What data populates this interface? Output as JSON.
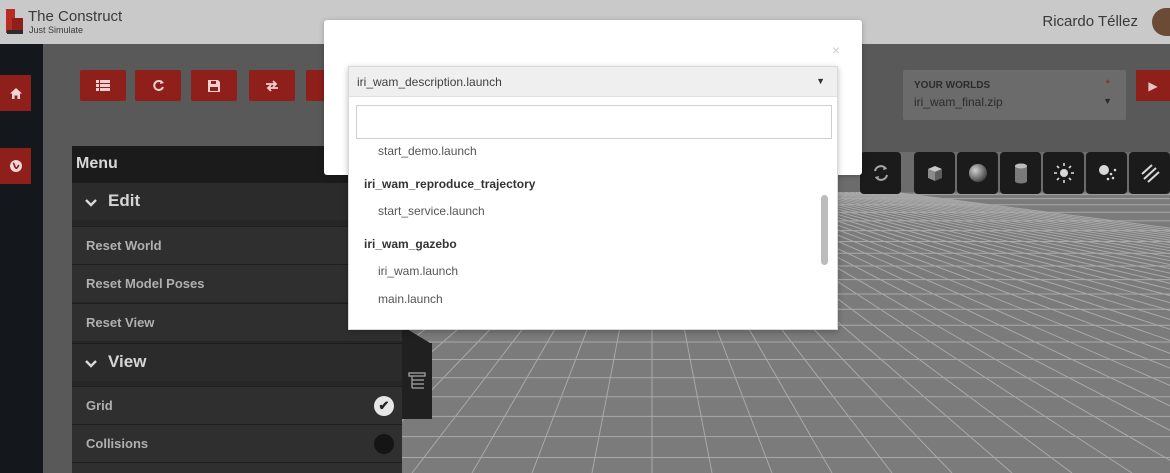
{
  "header": {
    "brand_title": "The Construct",
    "brand_subtitle": "Just Simulate",
    "user_name": "Ricardo Téllez"
  },
  "leftnav": {
    "items": [
      "home-icon",
      "globe-icon"
    ]
  },
  "toolbar": {
    "buttons": [
      "list-icon",
      "refresh-icon",
      "save-icon",
      "swap-icon",
      "extra-icon"
    ]
  },
  "worlds": {
    "label": "YOUR WORLDS",
    "required_mark": "*",
    "selected": "iri_wam_final.zip"
  },
  "view_tools": [
    "rotate-icon",
    "box-icon",
    "sphere-icon",
    "cylinder-icon",
    "sun-icon",
    "point-light-icon",
    "directional-light-icon"
  ],
  "menu": {
    "title": "Menu",
    "sections": [
      {
        "title": "Edit",
        "items": [
          "Reset World",
          "Reset Model Poses",
          "Reset View"
        ]
      },
      {
        "title": "View",
        "items": [
          "Grid",
          "Collisions"
        ]
      }
    ],
    "grid_checked": true,
    "collisions_checked": false
  },
  "modal": {
    "close": "×",
    "select": {
      "selected_value": "iri_wam_description.launch",
      "search_value": "",
      "options": [
        {
          "type": "item",
          "label": "start_demo.launch"
        },
        {
          "type": "group",
          "label": "iri_wam_reproduce_trajectory"
        },
        {
          "type": "item",
          "label": "start_service.launch"
        },
        {
          "type": "group",
          "label": "iri_wam_gazebo"
        },
        {
          "type": "item",
          "label": "iri_wam.launch"
        },
        {
          "type": "item",
          "label": "main.launch"
        }
      ]
    }
  },
  "colors": {
    "accent": "#8e1f1b",
    "nav_bg": "#14171c",
    "panel_bg": "#262626"
  }
}
